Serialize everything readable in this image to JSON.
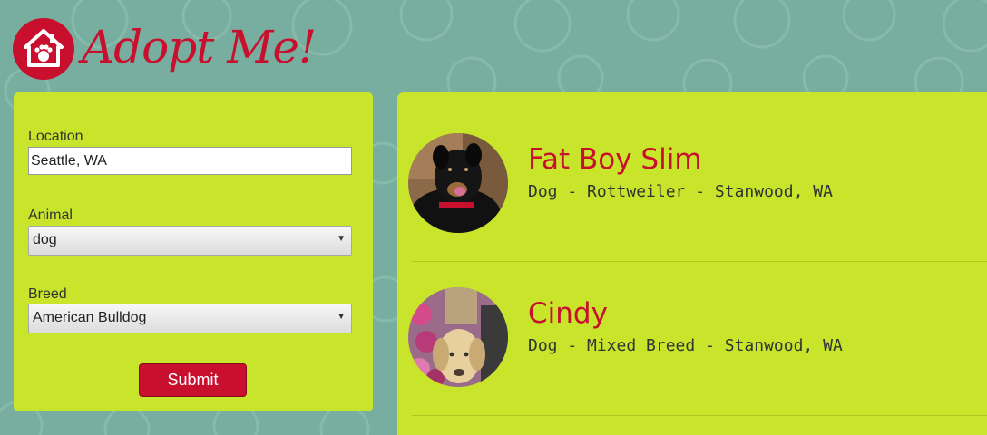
{
  "brand": {
    "name": "Adopt Me!",
    "logo_icon": "house-paw-icon",
    "accent": "#c8102e"
  },
  "search": {
    "location_label": "Location",
    "location_value": "Seattle, WA",
    "animal_label": "Animal",
    "animal_value": "dog",
    "breed_label": "Breed",
    "breed_value": "American Bulldog",
    "submit_label": "Submit"
  },
  "results": [
    {
      "name": "Fat Boy Slim",
      "info": "Dog - Rottweiler - Stanwood, WA",
      "photo": "black-dog-photo"
    },
    {
      "name": "Cindy",
      "info": "Dog - Mixed Breed - Stanwood, WA",
      "photo": "tan-dog-photo"
    }
  ],
  "colors": {
    "background": "#78ae9f",
    "panel": "#c9e52b",
    "accent": "#c8102e"
  }
}
